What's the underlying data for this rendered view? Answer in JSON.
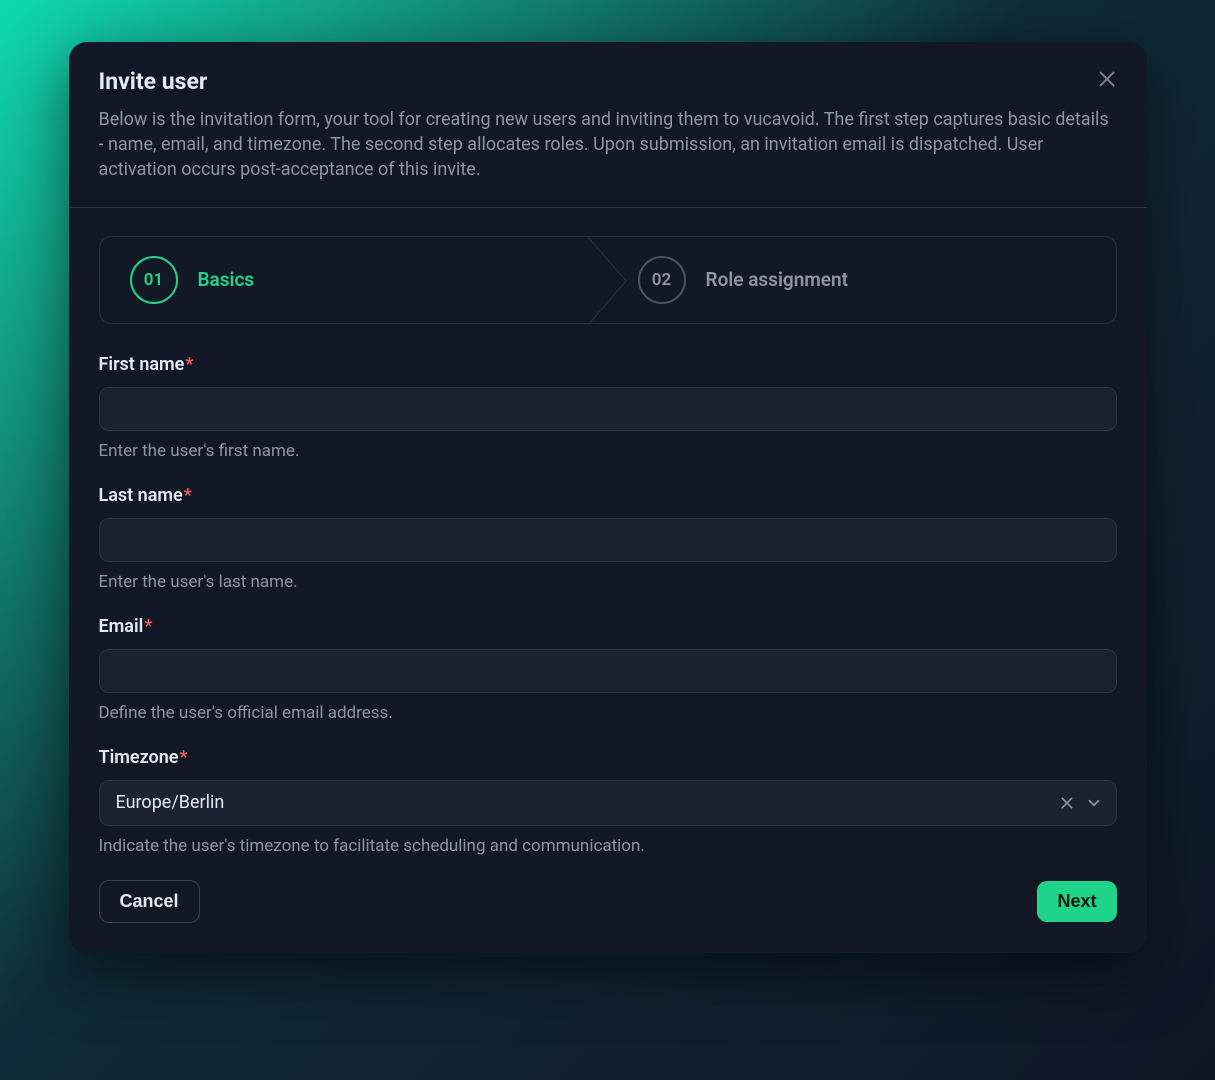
{
  "modal": {
    "title": "Invite user",
    "description": "Below is the invitation form, your tool for creating new users and inviting them to vucavoid. The first step captures basic details - name, email, and timezone. The second step allocates roles. Upon submission, an invitation email is dispatched. User activation occurs post-acceptance of this invite."
  },
  "stepper": {
    "steps": [
      {
        "num": "01",
        "label": "Basics",
        "active": true
      },
      {
        "num": "02",
        "label": "Role assignment",
        "active": false
      }
    ]
  },
  "fields": {
    "first_name": {
      "label": "First name",
      "required": true,
      "value": "",
      "hint": "Enter the user's first name."
    },
    "last_name": {
      "label": "Last name",
      "required": true,
      "value": "",
      "hint": "Enter the user's last name."
    },
    "email": {
      "label": "Email",
      "required": true,
      "value": "",
      "hint": "Define the user's official email address."
    },
    "timezone": {
      "label": "Timezone",
      "required": true,
      "value": "Europe/Berlin",
      "hint": "Indicate the user's timezone to facilitate scheduling and communication."
    }
  },
  "footer": {
    "cancel": "Cancel",
    "next": "Next"
  },
  "required_marker": "*"
}
